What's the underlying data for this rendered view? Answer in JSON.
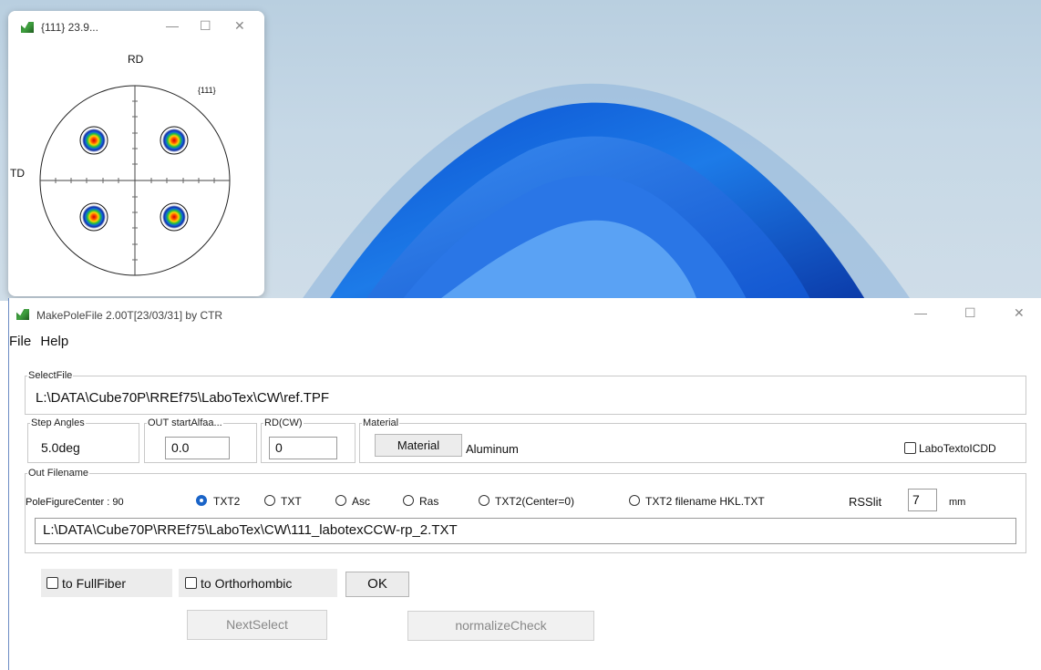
{
  "pole_window": {
    "title": "{111} 23.9...",
    "minimize": "—",
    "maximize": "☐",
    "close": "✕",
    "label_rd": "RD",
    "label_td": "TD",
    "label_plane": "{111}"
  },
  "main_window": {
    "title": "MakePoleFile 2.00T[23/03/31] by CTR",
    "minimize": "—",
    "maximize": "☐",
    "close": "✕"
  },
  "menu": {
    "file": "File",
    "help": "Help"
  },
  "select_file": {
    "legend": "SelectFile",
    "path": "L:\\DATA\\Cube70P\\RREf75\\LaboTex\\CW\\ref.TPF"
  },
  "step_angles": {
    "legend": "Step Angles",
    "value": "5.0deg"
  },
  "out_start": {
    "legend": "OUT startAlfaa...",
    "value": "0.0"
  },
  "rd_cw": {
    "legend": "RD(CW)",
    "value": "0"
  },
  "material": {
    "legend": "Material",
    "button": "Material",
    "value": "Aluminum"
  },
  "labo_check": {
    "label": "LaboTextoICDD",
    "checked": false
  },
  "out_filename": {
    "legend": "Out Filename",
    "pole_center": "PoleFigureCenter : 90",
    "options": [
      "TXT2",
      "TXT",
      "Asc",
      "Ras",
      "TXT2(Center=0)",
      "TXT2 filename  HKL.TXT"
    ],
    "selected": "TXT2",
    "rsslit_label": "RSSlit",
    "rsslit_value": "7",
    "rsslit_unit": "mm",
    "path": "L:\\DATA\\Cube70P\\RREf75\\LaboTex\\CW\\111_labotexCCW-rp_2.TXT"
  },
  "bottom": {
    "to_fullfiber": "to FullFiber",
    "to_orthorhombic": "to Orthorhombic",
    "ok": "OK",
    "next_select": "NextSelect",
    "normalize_check": "normalizeCheck"
  }
}
